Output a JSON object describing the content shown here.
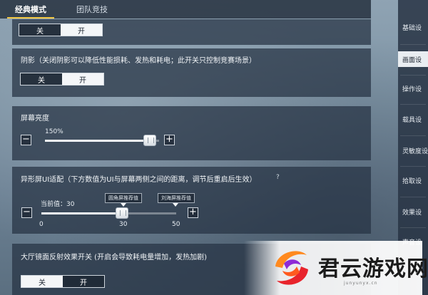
{
  "tabs": [
    {
      "label": "经典模式",
      "active": true
    },
    {
      "label": "团队竞技",
      "active": false
    }
  ],
  "toggle_top": {
    "off": "关",
    "on": "开",
    "selected": "on"
  },
  "shadow": {
    "title": "阴影（关闭阴影可以降低性能损耗、发热和耗电；此开关只控制竞赛场景）",
    "off": "关",
    "on": "开",
    "selected": "on"
  },
  "brightness": {
    "title": "屏幕亮度",
    "value_label": "150%",
    "fraction": 0.92,
    "minus": "−",
    "plus": "+"
  },
  "notch": {
    "title": "异形屏UI适配（下方数值为UI与屏幕两侧之间的距离，调节后重启后生效）",
    "help": "?",
    "current_label": "当前值：30",
    "value": 30,
    "min": 0,
    "max": 50,
    "ticks": [
      "0",
      "30",
      "50"
    ],
    "flag_round": "圆角屏推荐值",
    "flag_notch": "刘海屏推荐值",
    "minus": "−",
    "plus": "+"
  },
  "mirror": {
    "title": "大厅镜面反射效果开关 (开启会导致耗电量增加，发热加剧)",
    "off": "关",
    "on": "开",
    "selected": "off"
  },
  "side_menu": [
    {
      "label": "基础设",
      "active": false
    },
    {
      "label": "画面设",
      "active": true
    },
    {
      "label": "操作设",
      "active": false
    },
    {
      "label": "载具设",
      "active": false
    },
    {
      "label": "灵敏度设",
      "active": false
    },
    {
      "label": "拾取设",
      "active": false
    },
    {
      "label": "效果设",
      "active": false
    },
    {
      "label": "声音设",
      "active": false
    }
  ],
  "watermark": {
    "text": "君云游戏网",
    "sub": "junyunyx.cn"
  },
  "colors": {
    "accent": "#f2c744",
    "panel": "#263242"
  }
}
